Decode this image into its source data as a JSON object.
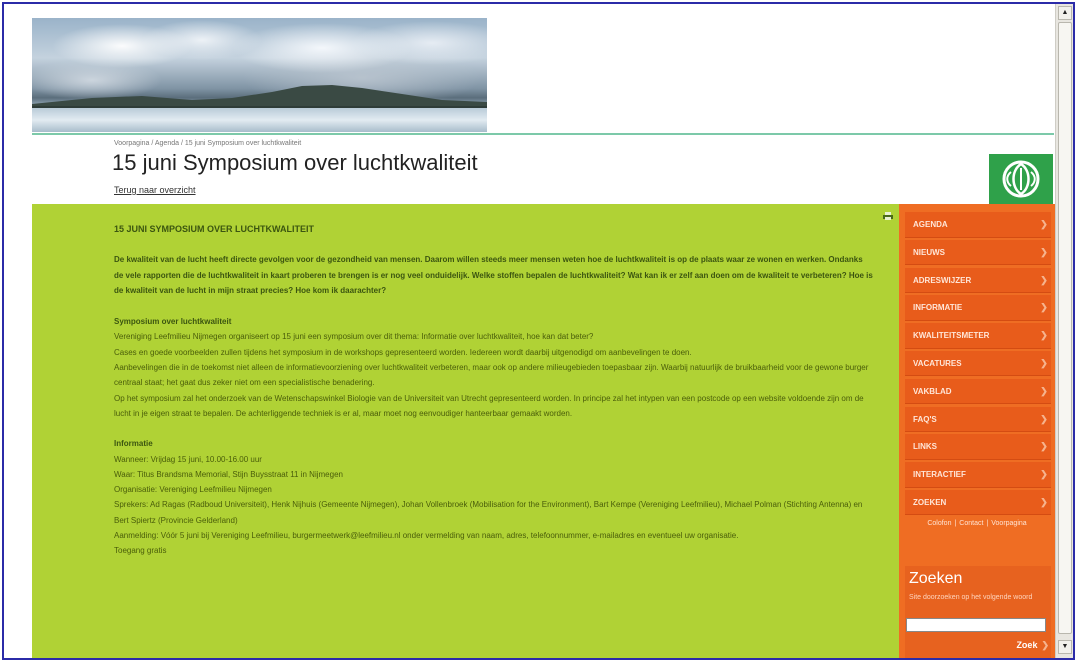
{
  "breadcrumb": "Voorpagina / Agenda / 15 juni Symposium over luchtkwaliteit",
  "page_title": "15 juni Symposium over luchtkwaliteit",
  "back_link": "Terug naar overzicht",
  "article": {
    "heading": "15 JUNI SYMPOSIUM OVER LUCHTKWALITEIT",
    "intro": "De kwaliteit van de lucht heeft directe gevolgen voor de gezondheid van mensen. Daarom willen steeds meer mensen weten hoe de luchtkwaliteit is op de plaats waar ze wonen en werken. Ondanks de vele rapporten die de luchtkwaliteit in kaart proberen te brengen is er nog veel onduidelijk. Welke stoffen bepalen de luchtkwaliteit? Wat kan ik er zelf aan doen om de kwaliteit te verbeteren? Hoe is de kwaliteit van de lucht in mijn straat precies? Hoe kom ik daarachter?",
    "symposium": {
      "heading": "Symposium over luchtkwaliteit",
      "lines": [
        "Vereniging Leefmilieu Nijmegen organiseert op 15 juni een symposium over dit thema: Informatie over luchtkwaliteit, hoe kan dat beter?",
        "Cases en goede voorbeelden zullen tijdens het symposium in de workshops gepresenteerd worden. Iedereen wordt daarbij uitgenodigd om aanbevelingen te doen.",
        "Aanbevelingen die in de toekomst niet alleen de informatievoorziening over luchtkwaliteit verbeteren, maar ook op andere milieugebieden toepasbaar zijn. Waarbij natuurlijk de bruikbaarheid voor de gewone burger centraal staat; het gaat dus zeker niet om een specialistische benadering.",
        "Op het symposium zal het onderzoek van de Wetenschapswinkel Biologie van de Universiteit van Utrecht gepresenteerd worden. In principe zal het intypen van een postcode op een website voldoende zijn om de lucht in je eigen straat te bepalen. De achterliggende techniek is er al, maar moet nog eenvoudiger hanteerbaar gemaakt worden."
      ]
    },
    "informatie": {
      "heading": "Informatie",
      "lines": [
        "Wanneer: Vrijdag 15 juni, 10.00-16.00 uur",
        "Waar: Titus Brandsma Memorial, Stijn Buysstraat 11 in Nijmegen",
        "Organisatie: Vereniging Leefmilieu Nijmegen",
        "Sprekers: Ad Ragas (Radboud Universiteit), Henk Nijhuis (Gemeente Nijmegen), Johan Vollenbroek (Mobilisation for the Environment), Bart Kempe (Vereniging Leefmilieu), Michael Polman (Stichting Antenna) en Bert Spiertz (Provincie Gelderland)",
        "Aanmelding: Vóór 5 juni bij Vereniging Leefmilieu, burgermeetwerk@leefmilieu.nl onder vermelding van naam, adres, telefoonnummer, e-mailadres en eventueel uw organisatie.",
        "Toegang gratis"
      ]
    }
  },
  "menu": [
    "AGENDA",
    "NIEUWS",
    "ADRESWIJZER",
    "INFORMATIE",
    "KWALITEITSMETER",
    "VACATURES",
    "VAKBLAD",
    "FAQ'S",
    "LINKS",
    "INTERACTIEF",
    "ZOEKEN"
  ],
  "footer_links": [
    "Colofon",
    "Contact",
    "Voorpagina"
  ],
  "search": {
    "title": "Zoeken",
    "description": "Site doorzoeken op het volgende woord",
    "value": "",
    "button": "Zoek"
  },
  "colors": {
    "content_bg": "#b0d235",
    "sidebar_bg": "#ef6d23",
    "logo_green": "#2fa14a"
  },
  "icons": [
    "print-icon",
    "logo-icon",
    "chevron-right-icon",
    "scroll-up-icon",
    "scroll-down-icon"
  ]
}
